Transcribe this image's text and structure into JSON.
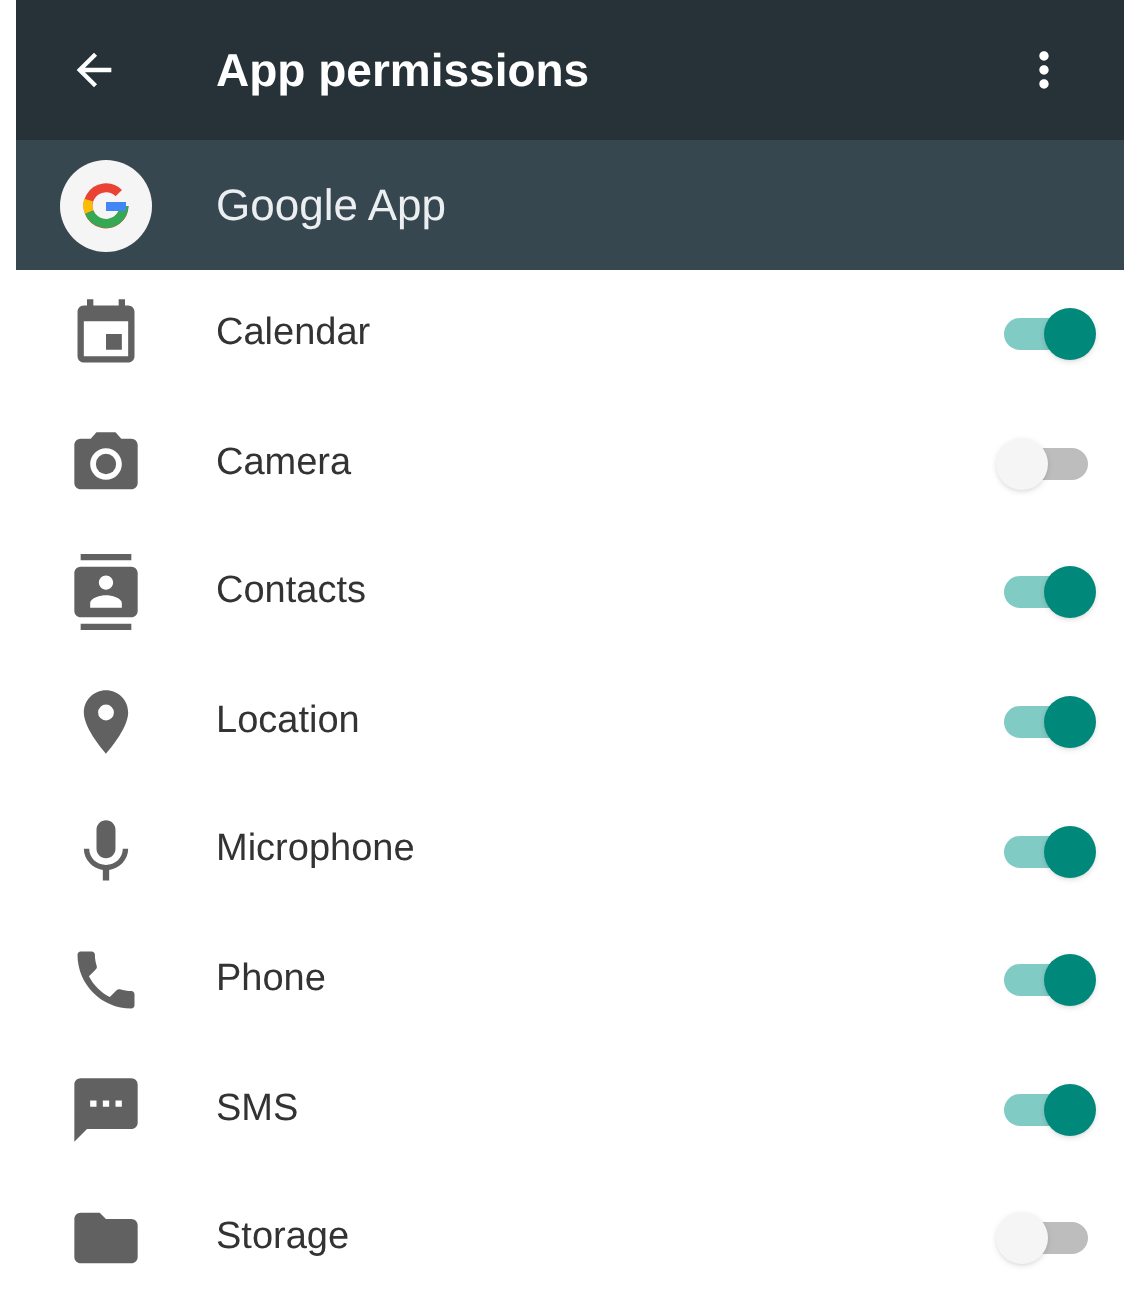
{
  "toolbar": {
    "title": "App permissions"
  },
  "app": {
    "name": "Google App"
  },
  "permissions": [
    {
      "kind": "calendar",
      "label": "Calendar",
      "on": true
    },
    {
      "kind": "camera",
      "label": "Camera",
      "on": false
    },
    {
      "kind": "contacts",
      "label": "Contacts",
      "on": true
    },
    {
      "kind": "location",
      "label": "Location",
      "on": true
    },
    {
      "kind": "microphone",
      "label": "Microphone",
      "on": true
    },
    {
      "kind": "phone",
      "label": "Phone",
      "on": true
    },
    {
      "kind": "sms",
      "label": "SMS",
      "on": true
    },
    {
      "kind": "storage",
      "label": "Storage",
      "on": false
    }
  ]
}
